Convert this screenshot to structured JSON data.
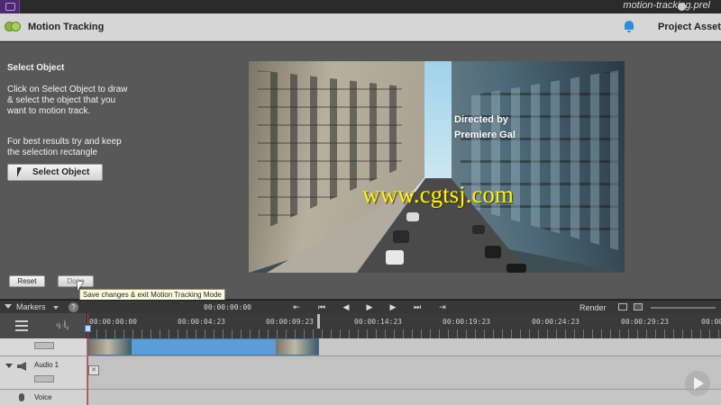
{
  "titlebar": {
    "document_name": "motion-tracking.prel"
  },
  "header": {
    "title": "Motion Tracking",
    "project_assets": "Project Assets"
  },
  "instructions": {
    "heading": "Select Object",
    "paragraph1": "Click on Select Object to draw & select the object that you want to motion track.",
    "paragraph2": "For best results try and keep the selection rectangle",
    "select_object_label": "Select Object"
  },
  "preview": {
    "overlay_line1": "Directed by",
    "overlay_line2": "Premiere Gal",
    "watermark": "www.cgtsj.com"
  },
  "buttons": {
    "reset": "Reset",
    "done": "Done",
    "done_tooltip": "Save changes & exit Motion Tracking Mode"
  },
  "timeline": {
    "markers_label": "Markers",
    "help": "?",
    "current_timecode": "00:00:00:00",
    "render_label": "Render",
    "transport": [
      "⇤",
      "⏮",
      "◀",
      "▶",
      "▶",
      "⏭",
      "⇥"
    ],
    "ruler_ticks": [
      "00:00:00:00",
      "00:00:04:23",
      "00:00:09:23",
      "00:00:14:23",
      "00:00:19:23",
      "00:00:24:23",
      "00:00:29:23",
      "00:00"
    ],
    "tracks": {
      "audio_label": "Audio 1",
      "voice_label": "Voice"
    }
  },
  "colors": {
    "header_bg": "#d6d6d6",
    "panel_bg": "#585858",
    "clip_blue": "#5a9ed8",
    "bell_blue": "#2c8ce0",
    "playhead_red": "#d63a3a",
    "watermark_yellow": "#ffef1a"
  }
}
